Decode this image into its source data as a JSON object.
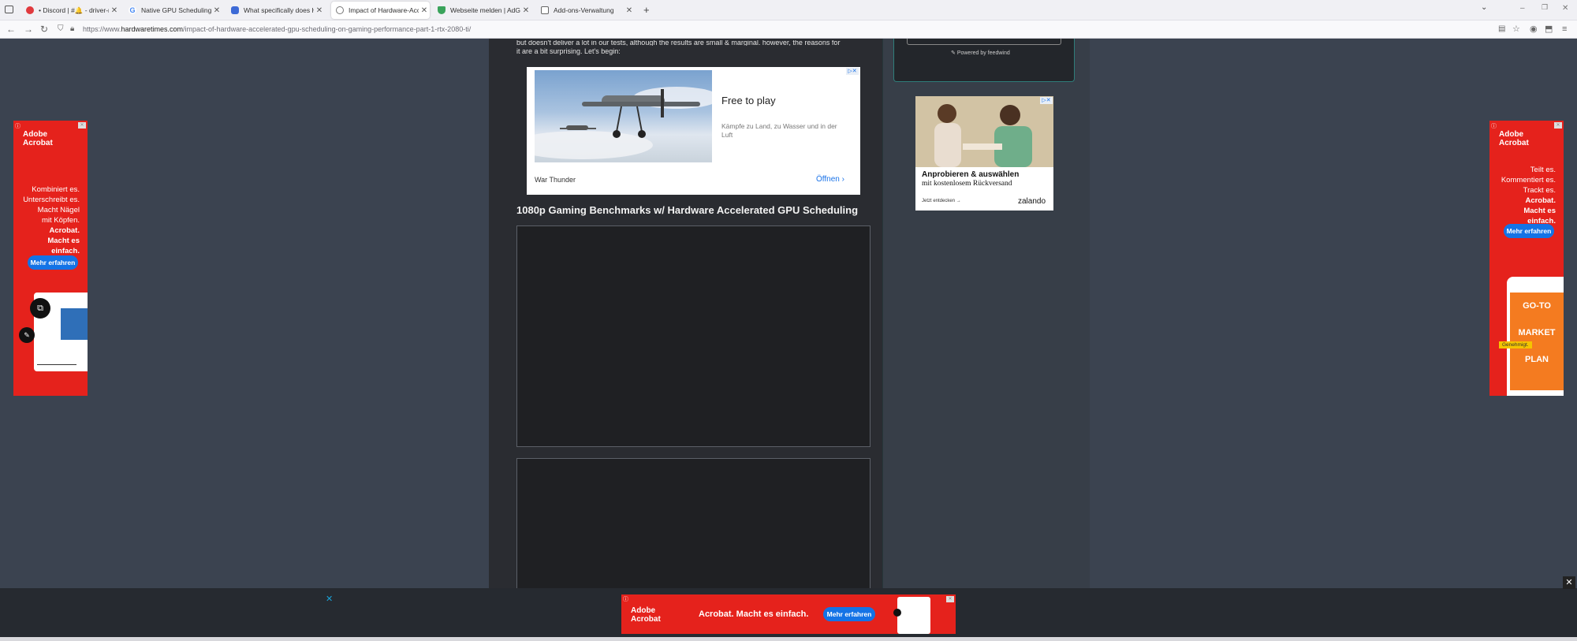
{
  "browser": {
    "tabs": [
      {
        "title": "• Discord | #🔔 - driver-releases",
        "favicon_color": "#e0393e"
      },
      {
        "title": "Native GPU Scheduling - Google",
        "favicon_color": "#4285f4"
      },
      {
        "title": "What specifically does Hardware",
        "favicon_color": "#3d6ad6"
      },
      {
        "title": "Impact of Hardware-Accelerated",
        "favicon_color": "#777777"
      },
      {
        "title": "Webseite melden | AdGuard",
        "favicon_color": "#3aa35b"
      },
      {
        "title": "Add-ons-Verwaltung",
        "favicon_color": "#666666"
      }
    ],
    "new_tab": "+",
    "url_prefix": "https://www.",
    "url_domain": "hardwaretimes.com",
    "url_path": "/impact-of-hardware-accelerated-gpu-scheduling-on-gaming-performance-part-1-rtx-2080-ti/"
  },
  "article": {
    "cut_line": "but doesn't deliver a lot in our tests, although the results are small & marginal. however, the reasons for",
    "intro": "it are a bit surprising. Let's begin:",
    "section_heading": "1080p Gaming Benchmarks w/ Hardware Accelerated GPU Scheduling"
  },
  "ad_war_thunder": {
    "title": "Free to play",
    "description": "Kämpfe zu Land, zu Wasser und in der Luft",
    "brand": "War Thunder",
    "cta": "Öffnen"
  },
  "sidebar": {
    "powered_by": "Powered by feedwind"
  },
  "ad_zalando": {
    "headline": "Anprobieren & auswählen",
    "subline": "mit kostenlosem Rückversand",
    "link": "Jetzt entdecken",
    "brand": "zalando"
  },
  "ad_acrobat_left": {
    "logo_line1": "Adobe",
    "logo_line2": "Acrobat",
    "lines": [
      "Kombiniert es.",
      "Unterschreibt es.",
      "Macht Nägel",
      "mit Köpfen."
    ],
    "bold": "Acrobat. Macht es einfach.",
    "cta": "Mehr erfahren"
  },
  "ad_acrobat_right": {
    "logo_line1": "Adobe",
    "logo_line2": "Acrobat",
    "lines": [
      "Teilt es.",
      "Kommentiert es.",
      "Trackt es."
    ],
    "bold": "Acrobat. Macht es einfach.",
    "cta": "Mehr erfahren",
    "phone_text": [
      "GO-TO",
      "MARKET",
      "PLAN"
    ],
    "stamp": "Genehmigt."
  },
  "ad_bottom": {
    "logo_line1": "Adobe",
    "logo_line2": "Acrobat",
    "slogan": "Acrobat. Macht es einfach.",
    "cta": "Mehr erfahren"
  },
  "colors": {
    "acrobat_red": "#e5221c",
    "cta_blue": "#1473e6",
    "teal_close": "#1aa3d9"
  }
}
